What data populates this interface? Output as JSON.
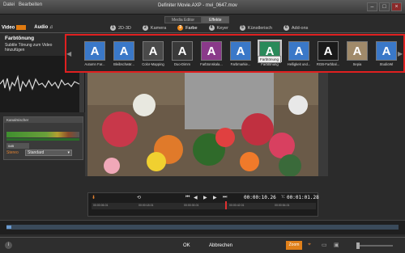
{
  "window": {
    "title": "Definiter Movie.AXP - mvi_0647.mov",
    "menu": [
      "Datei",
      "Bearbeiten"
    ]
  },
  "mode_tabs": [
    "Media Editor",
    "Effekte"
  ],
  "media_tabs": {
    "video": "Video",
    "audio": "Audio"
  },
  "category_tabs": [
    {
      "num": "1",
      "label": "2D-3D"
    },
    {
      "num": "2",
      "label": "Kamera"
    },
    {
      "num": "3",
      "label": "Farbe"
    },
    {
      "num": "4",
      "label": "Keyer"
    },
    {
      "num": "5",
      "label": "Künstlerisch"
    },
    {
      "num": "6",
      "label": "Add-ons"
    }
  ],
  "panel": {
    "title": "Farbtönung",
    "description": "Subtile Tönung zum Video hinzufügen"
  },
  "audio_settings": {
    "header": "Kanalmischer",
    "level_value": "0dB",
    "stereo_label": "Stereo",
    "stereo_value": "Standard"
  },
  "filters": [
    {
      "label": "Autumn Far...",
      "color": "#3a78c8"
    },
    {
      "label": "Bleibschwär...",
      "color": "#3a78c8"
    },
    {
      "label": "Color-Mapping",
      "color": "#4a4a4a"
    },
    {
      "label": "Duo-Dimm",
      "color": "#3a3a3a"
    },
    {
      "label": "Farbtonskala...",
      "color": "#8a3a8a"
    },
    {
      "label": "Farbmarkie...",
      "color": "#3a78c8"
    },
    {
      "label": "Farbtönung",
      "color": "#2a8a5a"
    },
    {
      "label": "Helligkeit und...",
      "color": "#3a78c8"
    },
    {
      "label": "RGB-Farbbal...",
      "color": "#1a1a1a"
    },
    {
      "label": "Sepia",
      "color": "#a08a6a"
    },
    {
      "label": "StudioWi",
      "color": "#3a78c8"
    }
  ],
  "tooltip": "Farbtönung",
  "transport": {
    "timecode": "00:00:10.26",
    "duration_prefix": "TC",
    "duration": "00:01:01.28",
    "ruler": [
      "00:00:06.01",
      "00:00:18.01",
      "00:00:30.01",
      "00:00:42.01",
      "00:00:54.01"
    ]
  },
  "bottom": {
    "ok": "OK",
    "cancel": "Abbrechen",
    "zoom": "Zoom"
  },
  "colors": {
    "accent": "#f08a1a",
    "highlight_border": "#e02020"
  }
}
